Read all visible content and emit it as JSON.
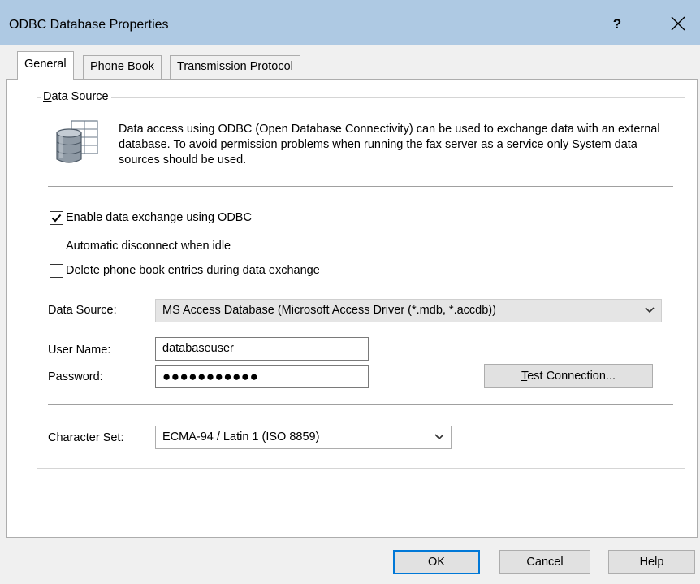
{
  "window": {
    "title": "ODBC Database Properties",
    "help_label": "?",
    "close_icon": "close-icon",
    "titlebar_color": "#aec9e3"
  },
  "tabs": [
    {
      "label": "General",
      "active": true
    },
    {
      "label": "Phone Book",
      "active": false
    },
    {
      "label": "Transmission Protocol",
      "active": false
    }
  ],
  "group": {
    "legend_accel": "D",
    "legend_rest": "ata Source",
    "icon": "database-icon",
    "description": "Data access using ODBC (Open Database Connectivity) can be used to exchange data with an external database. To avoid permission problems when running the fax server as a service only System data sources should be used."
  },
  "checkboxes": {
    "enable_odbc": {
      "label": "Enable data exchange using ODBC",
      "checked": true
    },
    "auto_disconnect": {
      "label": "Automatic disconnect when idle",
      "checked": false
    },
    "delete_entries": {
      "label": "Delete phone book entries during data exchange",
      "checked": false
    }
  },
  "fields": {
    "data_source_label": "Data Source:",
    "data_source_value": "MS Access Database (Microsoft Access Driver (*.mdb, *.accdb))",
    "user_name_label": "User Name:",
    "user_name_value": "databaseuser",
    "password_label": "Password:",
    "password_mask": "●●●●●●●●●●●",
    "charset_label": "Character Set:",
    "charset_value": "ECMA-94 / Latin 1 (ISO 8859)"
  },
  "buttons": {
    "test_connection_accel": "T",
    "test_connection_rest": "est Connection...",
    "ok": "OK",
    "cancel": "Cancel",
    "help": "Help"
  },
  "colors": {
    "default_button_border": "#0078d7"
  }
}
